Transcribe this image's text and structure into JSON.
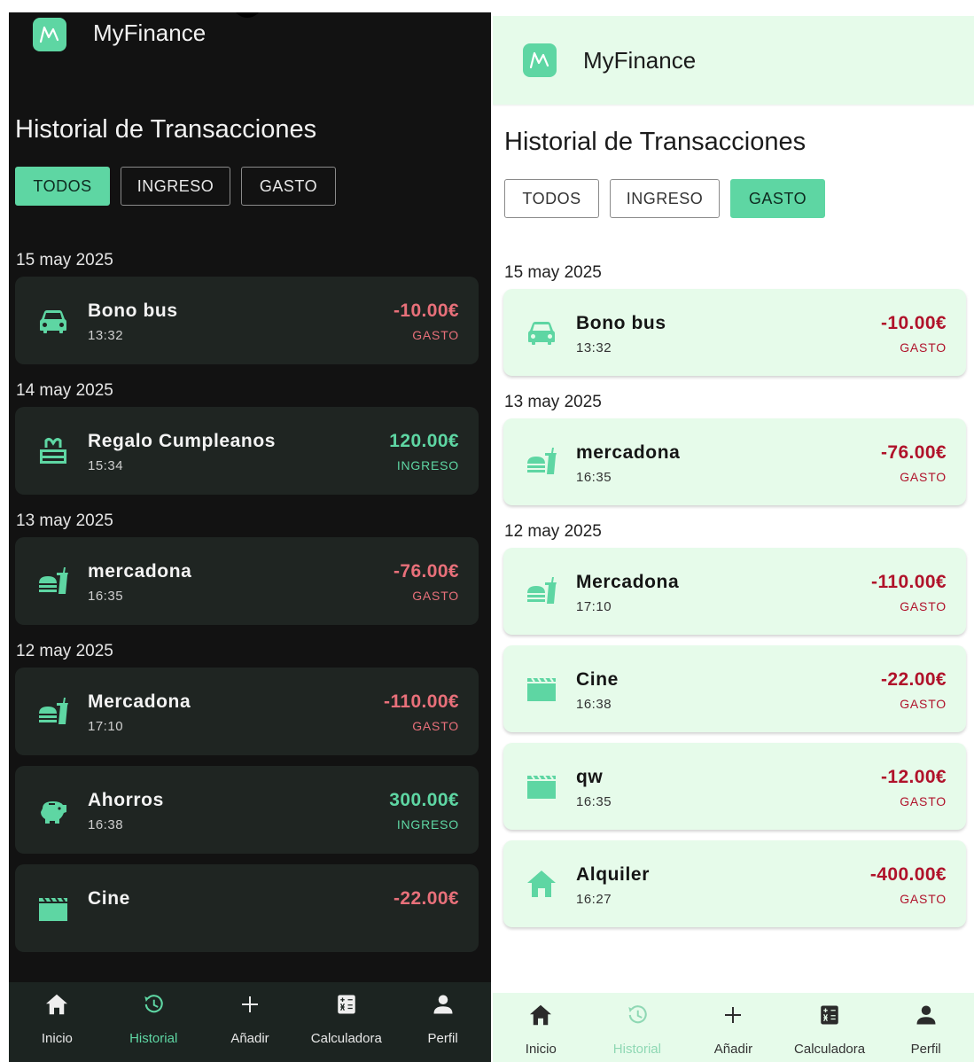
{
  "colors": {
    "accent": "#5ed6a3",
    "dark_background": "#121212",
    "dark_card": "#1f2522",
    "light_surface": "#e6fbea",
    "dark_negative": "#e8707a",
    "light_negative": "#b0122a"
  },
  "screens": [
    {
      "theme": "dark",
      "app_title": "MyFinance",
      "page_title": "Historial de Transacciones",
      "filters": [
        {
          "label": "TODOS",
          "active": true
        },
        {
          "label": "INGRESO",
          "active": false
        },
        {
          "label": "GASTO",
          "active": false
        }
      ],
      "groups": [
        {
          "date": "15 may 2025",
          "items": [
            {
              "icon": "car-icon",
              "name": "Bono bus",
              "time": "13:32",
              "amount": "-10.00€",
              "type": "GASTO"
            }
          ]
        },
        {
          "date": "14 may 2025",
          "items": [
            {
              "icon": "gift-cake-icon",
              "name": "Regalo Cumpleanos",
              "time": "15:34",
              "amount": "120.00€",
              "type": "INGRESO"
            }
          ]
        },
        {
          "date": "13 may 2025",
          "items": [
            {
              "icon": "fastfood-icon",
              "name": "mercadona",
              "time": "16:35",
              "amount": "-76.00€",
              "type": "GASTO"
            }
          ]
        },
        {
          "date": "12 may 2025",
          "items": [
            {
              "icon": "fastfood-icon",
              "name": "Mercadona",
              "time": "17:10",
              "amount": "-110.00€",
              "type": "GASTO"
            },
            {
              "icon": "piggy-bank-icon",
              "name": "Ahorros",
              "time": "16:38",
              "amount": "300.00€",
              "type": "INGRESO"
            },
            {
              "icon": "movie-icon",
              "name": "Cine",
              "time": "",
              "amount": "-22.00€",
              "type": ""
            }
          ]
        }
      ],
      "nav": [
        {
          "icon": "home-icon",
          "label": "Inicio",
          "active": false
        },
        {
          "icon": "history-icon",
          "label": "Historial",
          "active": true
        },
        {
          "icon": "plus-icon",
          "label": "Añadir",
          "active": false
        },
        {
          "icon": "calculator-icon",
          "label": "Calculadora",
          "active": false
        },
        {
          "icon": "person-icon",
          "label": "Perfil",
          "active": false
        }
      ]
    },
    {
      "theme": "light",
      "app_title": "MyFinance",
      "page_title": "Historial de Transacciones",
      "filters": [
        {
          "label": "TODOS",
          "active": false
        },
        {
          "label": "INGRESO",
          "active": false
        },
        {
          "label": "GASTO",
          "active": true
        }
      ],
      "groups": [
        {
          "date": "15 may 2025",
          "items": [
            {
              "icon": "car-icon",
              "name": "Bono bus",
              "time": "13:32",
              "amount": "-10.00€",
              "type": "GASTO"
            }
          ]
        },
        {
          "date": "13 may 2025",
          "items": [
            {
              "icon": "fastfood-icon",
              "name": "mercadona",
              "time": "16:35",
              "amount": "-76.00€",
              "type": "GASTO"
            }
          ]
        },
        {
          "date": "12 may 2025",
          "items": [
            {
              "icon": "fastfood-icon",
              "name": "Mercadona",
              "time": "17:10",
              "amount": "-110.00€",
              "type": "GASTO"
            },
            {
              "icon": "movie-icon",
              "name": "Cine",
              "time": "16:38",
              "amount": "-22.00€",
              "type": "GASTO"
            },
            {
              "icon": "movie-icon",
              "name": "qw",
              "time": "16:35",
              "amount": "-12.00€",
              "type": "GASTO"
            },
            {
              "icon": "home-icon",
              "name": "Alquiler",
              "time": "16:27",
              "amount": "-400.00€",
              "type": "GASTO"
            }
          ]
        }
      ],
      "nav": [
        {
          "icon": "home-icon",
          "label": "Inicio",
          "active": false
        },
        {
          "icon": "history-icon",
          "label": "Historial",
          "active": true
        },
        {
          "icon": "plus-icon",
          "label": "Añadir",
          "active": false
        },
        {
          "icon": "calculator-icon",
          "label": "Calculadora",
          "active": false
        },
        {
          "icon": "person-icon",
          "label": "Perfil",
          "active": false
        }
      ]
    }
  ]
}
